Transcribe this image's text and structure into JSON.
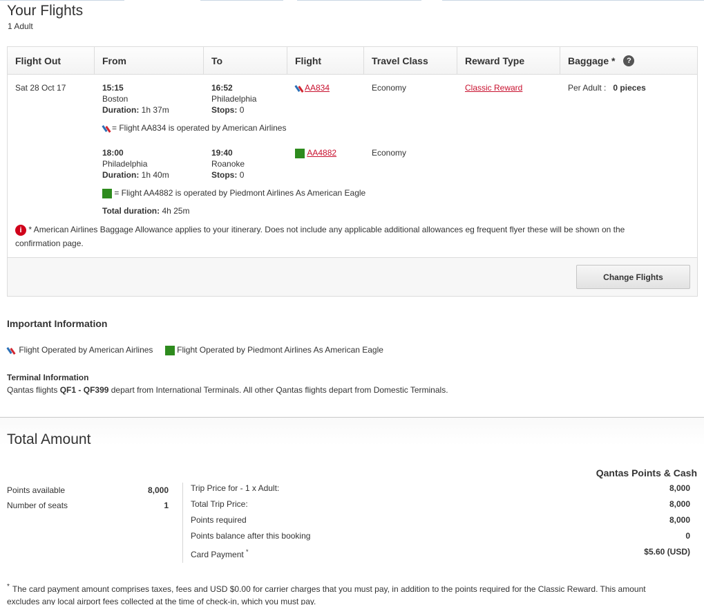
{
  "header": {
    "title": "Your Flights",
    "passengers": "1 Adult"
  },
  "table": {
    "columns": [
      "Flight Out",
      "From",
      "To",
      "Flight",
      "Travel Class",
      "Reward Type",
      "Baggage *"
    ],
    "date": "Sat 28 Oct 17",
    "segments": [
      {
        "depart_time": "15:15",
        "depart_city": "Boston",
        "duration_label": "Duration:",
        "duration": "1h 37m",
        "arrive_time": "16:52",
        "arrive_city": "Philadelphia",
        "stops_label": "Stops:",
        "stops": "0",
        "flight": "AA834",
        "travel_class": "Economy",
        "operated_note": "= Flight AA834 is operated by American Airlines",
        "logo_icon": "american-airlines-logo-icon"
      },
      {
        "depart_time": "18:00",
        "depart_city": "Philadelphia",
        "duration_label": "Duration:",
        "duration": "1h 40m",
        "arrive_time": "19:40",
        "arrive_city": "Roanoke",
        "stops_label": "Stops:",
        "stops": "0",
        "flight": "AA4882",
        "travel_class": "Economy",
        "operated_note": "= Flight AA4882 is operated by Piedmont Airlines As American Eagle",
        "logo_icon": "piedmont-airlines-logo-icon"
      }
    ],
    "reward_type": "Classic Reward",
    "baggage_label": "Per Adult :",
    "baggage_value": "0 pieces",
    "total_duration_label": "Total duration:",
    "total_duration": "4h 25m",
    "baggage_notice": "* American Airlines Baggage Allowance applies to your itinerary. Does not include any applicable additional allowances eg frequent flyer these will be shown on the",
    "baggage_notice_cont": "confirmation page.",
    "change_button": "Change Flights"
  },
  "important": {
    "title": "Important Information",
    "legend_aa": "Flight Operated by American Airlines",
    "legend_piedmont": "Flight Operated by Piedmont Airlines As American Eagle",
    "terminal_title": "Terminal Information",
    "terminal_pre": "Qantas flights ",
    "terminal_from": "QF1",
    "terminal_sep": " - ",
    "terminal_to": "QF399",
    "terminal_post": " depart from International Terminals. All other Qantas flights depart from Domestic Terminals."
  },
  "total": {
    "title": "Total Amount",
    "column_label": "Qantas Points & Cash",
    "stats": [
      {
        "label": "Points available",
        "value": "8,000"
      },
      {
        "label": "Number of seats",
        "value": "1"
      }
    ],
    "prices": [
      {
        "label": "Trip Price for - 1 x Adult:",
        "value": "8,000"
      },
      {
        "label": "Total Trip Price:",
        "value": "8,000"
      },
      {
        "label": "Points required",
        "value": "8,000"
      },
      {
        "label": "Points balance after this booking",
        "value": "0"
      },
      {
        "label": "Card Payment",
        "value": "$5.60 (USD)"
      }
    ],
    "footnote_mark": "*",
    "footnote_line1": "The card payment amount comprises taxes, fees and USD $0.00 for carrier charges that you must pay, in addition to the points required for the Classic Reward. This amount",
    "footnote_line2": "excludes any local airport fees collected at the time of check-in, which you must pay."
  },
  "colors": {
    "link": "#c8102e",
    "aa_red": "#d22630",
    "aa_blue": "#2b6fb6",
    "piedmont_green": "#2e8b1e",
    "alert_red": "#d0021b"
  }
}
